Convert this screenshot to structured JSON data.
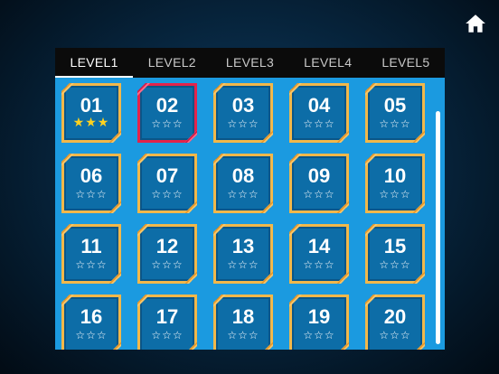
{
  "tabs": [
    {
      "label": "LEVEL1",
      "active": true
    },
    {
      "label": "LEVEL2",
      "active": false
    },
    {
      "label": "LEVEL3",
      "active": false
    },
    {
      "label": "LEVEL4",
      "active": false
    },
    {
      "label": "LEVEL5",
      "active": false
    }
  ],
  "levels": [
    {
      "number": "01",
      "stars": "★★★",
      "earned": 3,
      "selected": false
    },
    {
      "number": "02",
      "stars": "☆☆☆",
      "earned": 0,
      "selected": true
    },
    {
      "number": "03",
      "stars": "☆☆☆",
      "earned": 0,
      "selected": false
    },
    {
      "number": "04",
      "stars": "☆☆☆",
      "earned": 0,
      "selected": false
    },
    {
      "number": "05",
      "stars": "☆☆☆",
      "earned": 0,
      "selected": false
    },
    {
      "number": "06",
      "stars": "☆☆☆",
      "earned": 0,
      "selected": false
    },
    {
      "number": "07",
      "stars": "☆☆☆",
      "earned": 0,
      "selected": false
    },
    {
      "number": "08",
      "stars": "☆☆☆",
      "earned": 0,
      "selected": false
    },
    {
      "number": "09",
      "stars": "☆☆☆",
      "earned": 0,
      "selected": false
    },
    {
      "number": "10",
      "stars": "☆☆☆",
      "earned": 0,
      "selected": false
    },
    {
      "number": "11",
      "stars": "☆☆☆",
      "earned": 0,
      "selected": false
    },
    {
      "number": "12",
      "stars": "☆☆☆",
      "earned": 0,
      "selected": false
    },
    {
      "number": "13",
      "stars": "☆☆☆",
      "earned": 0,
      "selected": false
    },
    {
      "number": "14",
      "stars": "☆☆☆",
      "earned": 0,
      "selected": false
    },
    {
      "number": "15",
      "stars": "☆☆☆",
      "earned": 0,
      "selected": false
    },
    {
      "number": "16",
      "stars": "☆☆☆",
      "earned": 0,
      "selected": false
    },
    {
      "number": "17",
      "stars": "☆☆☆",
      "earned": 0,
      "selected": false
    },
    {
      "number": "18",
      "stars": "☆☆☆",
      "earned": 0,
      "selected": false
    },
    {
      "number": "19",
      "stars": "☆☆☆",
      "earned": 0,
      "selected": false
    },
    {
      "number": "20",
      "stars": "☆☆☆",
      "earned": 0,
      "selected": false
    }
  ],
  "home_icon": "home-icon",
  "colors": {
    "grid_background": "#1b9ae0",
    "tile_fill": "#0d6da7",
    "tile_border": "#f2b84a",
    "selected_border": "#e3234b",
    "earned_star": "#ffd21f"
  }
}
